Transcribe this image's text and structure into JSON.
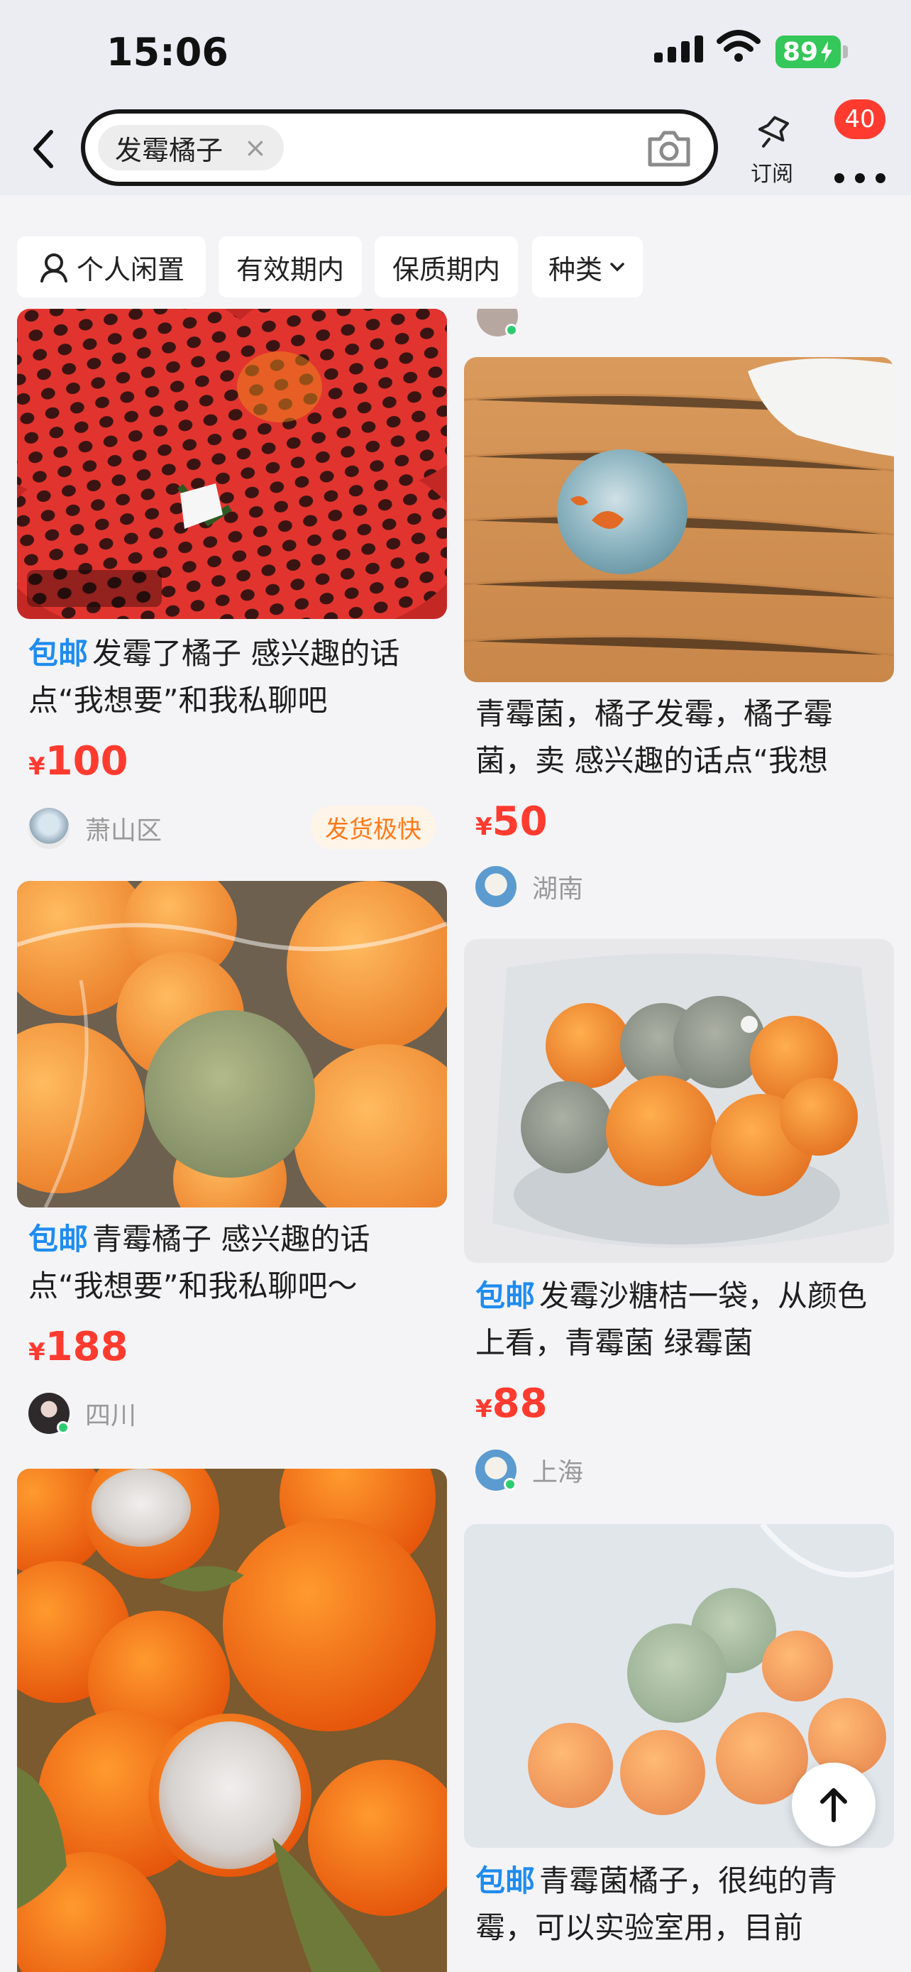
{
  "status_bar": {
    "time": "15:06",
    "battery": "89"
  },
  "nav": {
    "search_query": "发霉橘子",
    "clear_symbol": "×",
    "subscribe_label": "订阅",
    "more_badge": "40"
  },
  "filters": [
    {
      "label": "个人闲置"
    },
    {
      "label": "有效期内"
    },
    {
      "label": "保质期内"
    },
    {
      "label": "种类"
    }
  ],
  "listings": [
    {
      "tag": "包邮",
      "title": "发霉了橘子 感兴趣的话点“我想要”和我私聊吧",
      "currency": "¥",
      "price": "100",
      "location": "萧山区",
      "badge": "发货极快"
    },
    {
      "tag": "",
      "title": "青霉菌，橘子发霉，橘子霉菌，卖 感兴趣的话点“我想",
      "currency": "¥",
      "price": "50",
      "location": "湖南"
    },
    {
      "tag": "包邮",
      "title": "青霉橘子 感兴趣的话点“我想要”和我私聊吧～",
      "currency": "¥",
      "price": "188",
      "location": "四川"
    },
    {
      "tag": "包邮",
      "title": "发霉沙糖桔一袋，从颜色上看，青霉菌 绿霉菌",
      "currency": "¥",
      "price": "88",
      "location": "上海"
    },
    {
      "tag": "包邮",
      "title": "青霉菌橘子，很纯的青霉，可以实验室用，目前"
    }
  ],
  "colors": {
    "accent_red": "#ff3b30",
    "tag_blue": "#1e8cf0",
    "ship_orange": "#ff7a1a"
  },
  "icons": [
    "back-icon",
    "camera-icon",
    "subscribe-icon",
    "more-icon",
    "person-icon",
    "chevron-down-icon",
    "arrow-up-icon"
  ]
}
